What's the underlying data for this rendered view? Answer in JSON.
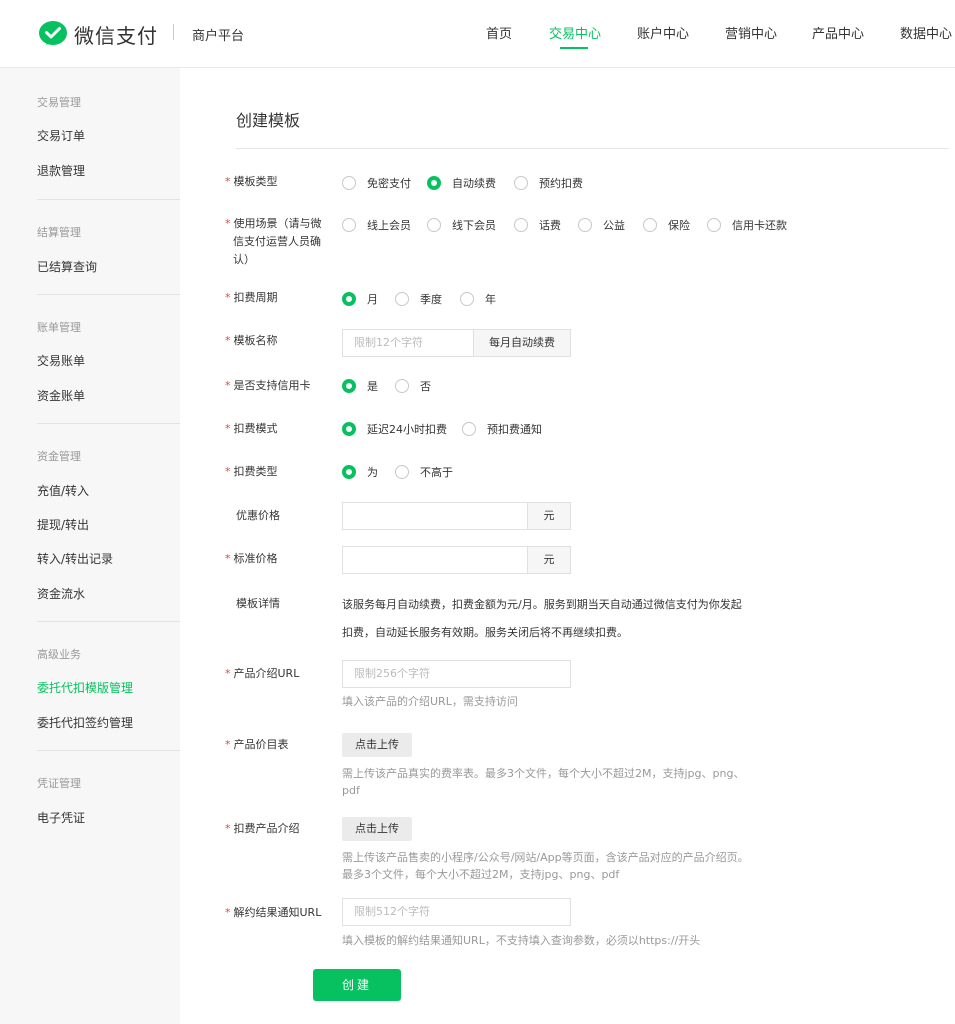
{
  "header": {
    "logo_text": "微信支付",
    "platform": "商户平台",
    "nav": [
      "首页",
      "交易中心",
      "账户中心",
      "营销中心",
      "产品中心",
      "数据中心"
    ],
    "active_nav": "交易中心",
    "accent": "#07c160"
  },
  "sidebar": {
    "groups": [
      {
        "title": "交易管理",
        "items": [
          "交易订单",
          "退款管理"
        ]
      },
      {
        "title": "结算管理",
        "items": [
          "已结算查询"
        ]
      },
      {
        "title": "账单管理",
        "items": [
          "交易账单",
          "资金账单"
        ]
      },
      {
        "title": "资金管理",
        "items": [
          "充值/转入",
          "提现/转出",
          "转入/转出记录",
          "资金流水"
        ]
      },
      {
        "title": "高级业务",
        "items": [
          "委托代扣模版管理",
          "委托代扣签约管理"
        ]
      },
      {
        "title": "凭证管理",
        "items": [
          "电子凭证"
        ]
      }
    ],
    "active_item": "委托代扣模版管理"
  },
  "form": {
    "title": "创建模板",
    "template_type": {
      "label": "模板类型",
      "options": [
        "免密支付",
        "自动续费",
        "预约扣费"
      ],
      "selected": "自动续费"
    },
    "scene": {
      "label_lines": [
        "使用场景（请与微",
        "信支付运营人员确",
        "认）"
      ],
      "options": [
        "线上会员",
        "线下会员",
        "话费",
        "公益",
        "保险",
        "信用卡还款"
      ],
      "selected": null
    },
    "period": {
      "label": "扣费周期",
      "options": [
        "月",
        "季度",
        "年"
      ],
      "selected": "月"
    },
    "name": {
      "label": "模板名称",
      "placeholder": "限制12个字符",
      "addon": "每月自动续费"
    },
    "credit": {
      "label": "是否支持信用卡",
      "options": [
        "是",
        "否"
      ],
      "selected": "是"
    },
    "mode": {
      "label": "扣费模式",
      "options": [
        "延迟24小时扣费",
        "预扣费通知"
      ],
      "selected": "延迟24小时扣费"
    },
    "fee_type": {
      "label": "扣费类型",
      "options": [
        "为",
        "不高于"
      ],
      "selected": "为"
    },
    "discount_price": {
      "label": "优惠价格",
      "unit": "元"
    },
    "standard_price": {
      "label": "标准价格",
      "unit": "元"
    },
    "detail": {
      "label": "模板详情",
      "lines": [
        "该服务每月自动续费，扣费金额为元/月。服务到期当天自动通过微信支付为你发起",
        "扣费，自动延长服务有效期。服务关闭后将不再继续扣费。"
      ]
    },
    "product_url": {
      "label": "产品介绍URL",
      "placeholder": "限制256个字符",
      "hint": "填入该产品的介绍URL，需支持访问"
    },
    "price_list": {
      "label": "产品价目表",
      "button": "点击上传",
      "hint_lines": [
        "需上传该产品真实的费率表。最多3个文件，每个大小不超过2M，支持jpg、png、",
        "pdf"
      ]
    },
    "product_intro": {
      "label": "扣费产品介绍",
      "button": "点击上传",
      "hint_lines": [
        "需上传该产品售卖的小程序/公众号/网站/App等页面，含该产品对应的产品介绍页。",
        "最多3个文件，每个大小不超过2M，支持jpg、png、pdf"
      ]
    },
    "cancel_url": {
      "label": "解约结果通知URL",
      "placeholder": "限制512个字符",
      "hint": "填入模板的解约结果通知URL，不支持填入查询参数，必须以https://开头"
    },
    "submit": "创建"
  }
}
